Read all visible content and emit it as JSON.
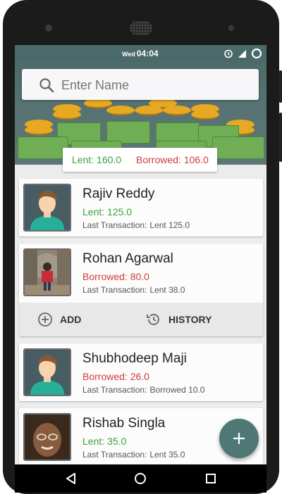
{
  "status": {
    "day": "Wed",
    "time": "04:04"
  },
  "search": {
    "placeholder": "Enter Name"
  },
  "summary": {
    "lent": "Lent: 160.0",
    "borrowed": "Borrowed: 106.0"
  },
  "contacts": [
    {
      "name": "Rajiv Reddy",
      "amount": "Lent: 125.0",
      "last_label": "Last Transaction:",
      "last_value": "Lent 125.0"
    },
    {
      "name": "Rohan Agarwal",
      "amount": "Borrowed: 80.0",
      "last_label": "Last Transaction:",
      "last_value": "Lent 38.0"
    },
    {
      "name": "Shubhodeep Maji",
      "amount": "Borrowed: 26.0",
      "last_label": "Last Transaction:",
      "last_value": "Borrowed 10.0"
    },
    {
      "name": "Rishab Singla",
      "amount": "Lent: 35.0",
      "last_label": "Last Transaction:",
      "last_value": "Lent 35.0"
    }
  ],
  "actions": {
    "add": "ADD",
    "history": "HISTORY"
  },
  "colors": {
    "accent": "#4f7775",
    "lent": "#3aa23a",
    "borrowed": "#d23a3a"
  },
  "icons": {
    "search": "search-icon",
    "add": "add-circle-icon",
    "history": "history-icon",
    "fab": "plus-icon",
    "back": "back-icon",
    "home": "home-icon",
    "recents": "recents-icon"
  }
}
